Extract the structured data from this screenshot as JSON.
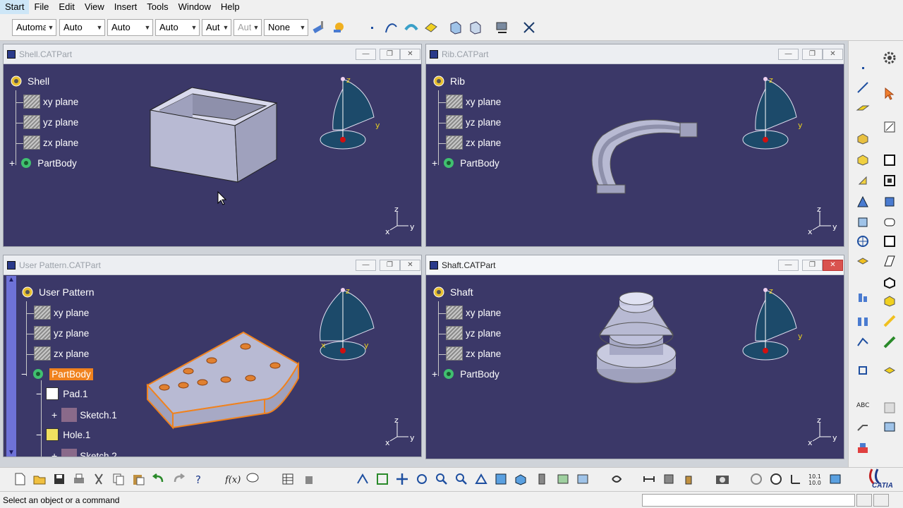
{
  "menu": [
    "Start",
    "File",
    "Edit",
    "View",
    "Insert",
    "Tools",
    "Window",
    "Help"
  ],
  "toolbar": {
    "combos": [
      "Automa",
      "Auto",
      "Auto",
      "Auto",
      "Aut",
      "Aut",
      "None"
    ]
  },
  "windows": [
    {
      "title": "Shell.CATPart",
      "root": "Shell",
      "items": [
        "xy plane",
        "yz plane",
        "zx plane",
        "PartBody"
      ]
    },
    {
      "title": "Rib.CATPart",
      "root": "Rib",
      "items": [
        "xy plane",
        "yz plane",
        "zx plane",
        "PartBody"
      ]
    },
    {
      "title": "User Pattern.CATPart",
      "root": "User Pattern",
      "items": [
        "xy plane",
        "yz plane",
        "zx plane",
        "PartBody"
      ],
      "sub": [
        "Pad.1",
        "Sketch.1",
        "Hole.1",
        "Sketch.2"
      ]
    },
    {
      "title": "Shaft.CATPart",
      "root": "Shaft",
      "items": [
        "xy plane",
        "yz plane",
        "zx plane",
        "PartBody"
      ]
    }
  ],
  "axis": {
    "x": "x",
    "y": "y",
    "z": "z"
  },
  "status": {
    "text": "Select an object or a command"
  },
  "brand": "CATIA",
  "colors": {
    "viewport": "#3b3868",
    "highlight": "#f0821e",
    "part": "#b9bcd8"
  }
}
